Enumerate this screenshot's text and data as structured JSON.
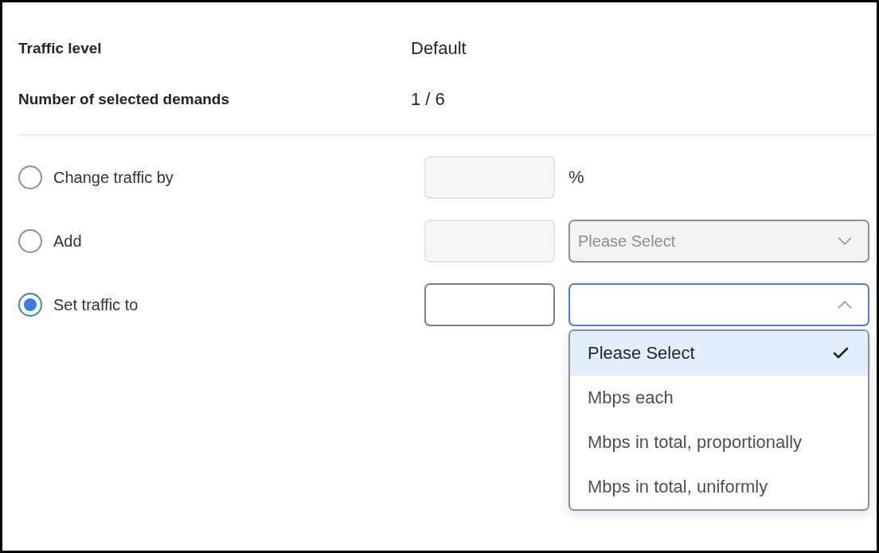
{
  "summary": [
    {
      "label": "Traffic level",
      "value": "Default"
    },
    {
      "label": "Number of selected demands",
      "value": "1 / 6"
    }
  ],
  "options": [
    {
      "label": "Change traffic by",
      "selected": false,
      "amount": {
        "disabled": true
      },
      "unit": {
        "kind": "suffix",
        "text": "%"
      }
    },
    {
      "label": "Add",
      "selected": false,
      "amount": {
        "disabled": true
      },
      "unit": {
        "kind": "select",
        "placeholder": "Please Select",
        "disabled": true,
        "expanded": false
      }
    },
    {
      "label": "Set traffic to",
      "selected": true,
      "amount": {
        "disabled": false
      },
      "unit": {
        "kind": "select",
        "disabled": false,
        "expanded": true,
        "items": [
          {
            "label": "Please Select",
            "selected": true
          },
          {
            "label": "Mbps each",
            "selected": false
          },
          {
            "label": "Mbps in total, proportionally",
            "selected": false
          },
          {
            "label": "Mbps in total, uniformly",
            "selected": false
          }
        ]
      }
    }
  ]
}
